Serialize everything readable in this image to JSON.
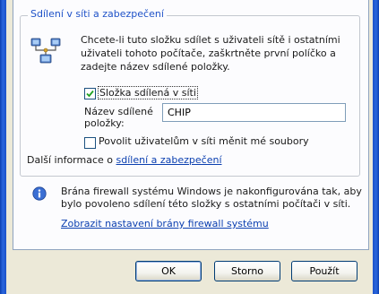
{
  "sharing": {
    "group_title": "Sdílení v síti a zabezpečení",
    "intro_text": "Chcete-li tuto složku sdílet s uživateli sítě i ostatními\nuživateli tohoto počítače, zaškrtněte první políčko a\nzadejte název sdílené položky.",
    "share_checkbox_label": "Složka sdílená v síti",
    "share_checked": true,
    "share_name_label": "Název sdílené\npoložky:",
    "share_name_value": "CHIP",
    "allow_checkbox_label": "Povolit uživatelům v síti měnit mé soubory",
    "allow_checked": false,
    "more_info_prefix": "Další informace o",
    "more_info_link": "sdílení a zabezpečení"
  },
  "firewall": {
    "message": "Brána firewall systému Windows je nakonfigurována tak, aby\nbylo povoleno sdílení této složky s ostatními počítači v síti.",
    "settings_link": "Zobrazit nastavení brány firewall systému"
  },
  "buttons": {
    "ok": "OK",
    "cancel": "Storno",
    "apply": "Použít"
  },
  "icons": {
    "share": "shared-folder-network-icon",
    "info": "info-icon"
  },
  "colors": {
    "accent": "#1f52c8",
    "link": "#0b3fb0"
  }
}
